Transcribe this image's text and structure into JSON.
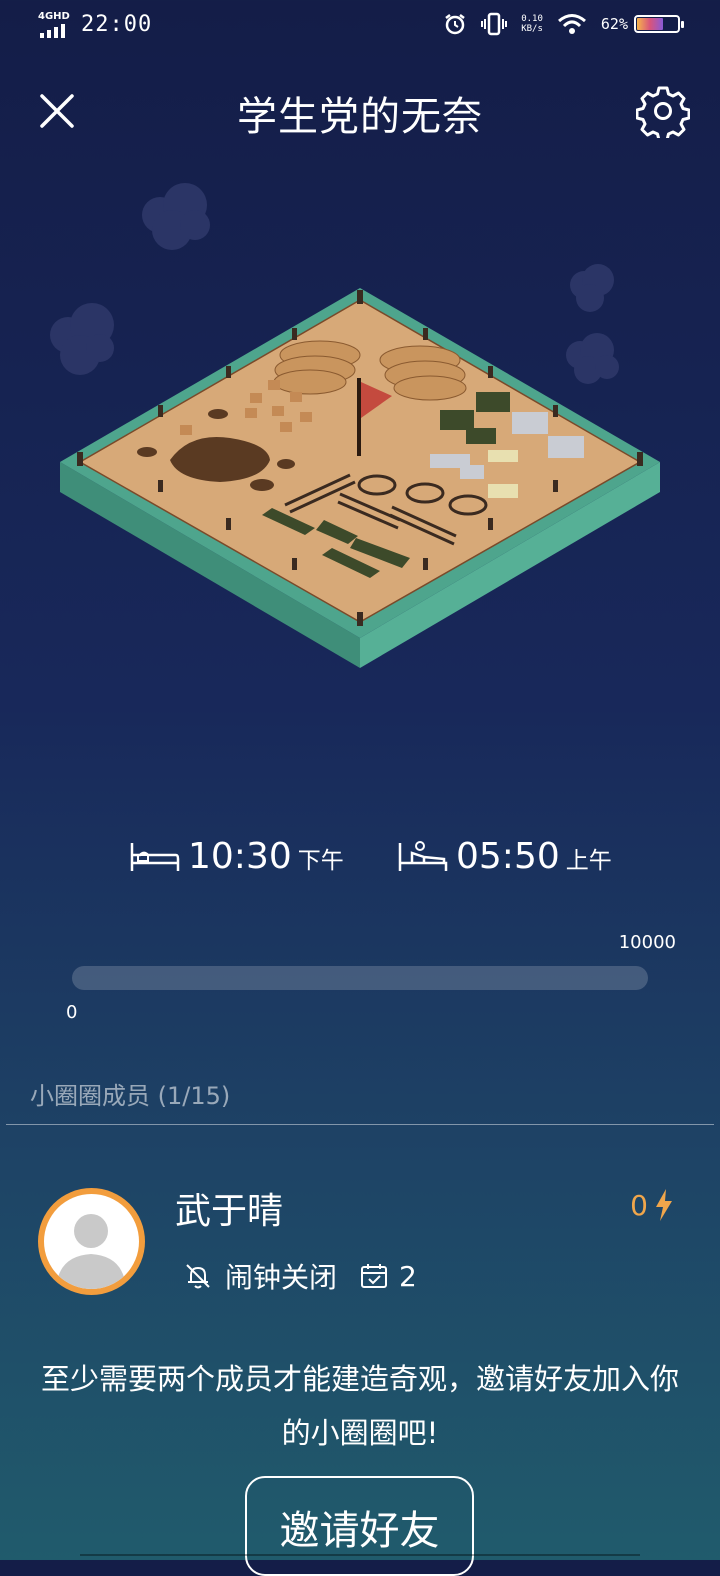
{
  "status_bar": {
    "network": "4GHD",
    "time": "22:00",
    "speed_value": "0.10",
    "speed_unit": "KB/s",
    "battery_percent": "62%",
    "battery_level": 0.62
  },
  "header": {
    "title": "学生党的无奈"
  },
  "sleep": {
    "bed_time": "10:30",
    "bed_ampm": "下午",
    "wake_time": "05:50",
    "wake_ampm": "上午"
  },
  "progress": {
    "max_label": "10000",
    "min_label": "0",
    "value_fraction": 0
  },
  "members": {
    "label": "小圈圈成员",
    "count": "(1/15)",
    "list": [
      {
        "name": "武于晴",
        "energy": "0",
        "alarm_status": "闹钟关闭",
        "checkins": "2"
      }
    ]
  },
  "invite": {
    "message": "至少需要两个成员才能建造奇观，邀请好友加入你的小圈圈吧!",
    "button_label": "邀请好友"
  },
  "colors": {
    "accent": "#f0a64b",
    "bg_top": "#141d48",
    "bg_bottom": "#205b6c",
    "island_sand": "#d7a978",
    "island_grass": "#4ea58d"
  },
  "icons": [
    "close-icon",
    "settings-icon",
    "bed-icon",
    "wake-icon",
    "bell-off-icon",
    "calendar-check-icon",
    "lightning-icon"
  ]
}
